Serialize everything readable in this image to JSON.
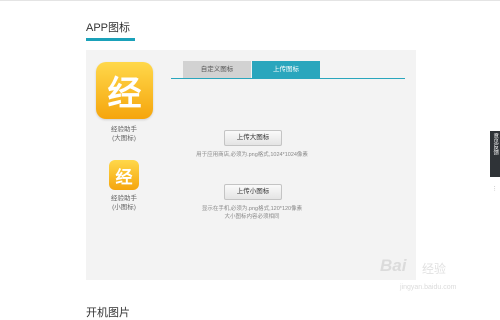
{
  "section": {
    "title": "APP图标",
    "next_title": "开机图片"
  },
  "tabs": [
    {
      "label": "自定义图标",
      "active": false
    },
    {
      "label": "上传图标",
      "active": true
    }
  ],
  "icons": {
    "big": {
      "glyph": "经",
      "name": "经验助手",
      "note": "(大图标)"
    },
    "small": {
      "glyph": "经",
      "name": "经验助手",
      "note": "(小图标)"
    }
  },
  "upload": {
    "big_button": "上传大图标",
    "big_hint": "用于应用商店,必须为.png格式,1024*1024像素",
    "small_button": "上传小图标",
    "small_hint_line1": "显示在手机,必须为.png格式,120*120像素",
    "small_hint_line2": "大小图标内容必须相同"
  },
  "side_widget": {
    "label": "意见反馈",
    "mark": "⋮"
  },
  "watermark": {
    "logo": "Bai",
    "suffix": "经验",
    "url": "jingyan.baidu.com"
  },
  "colors": {
    "accent": "#2aa6bd",
    "icon_gold": "#f5a50d"
  }
}
